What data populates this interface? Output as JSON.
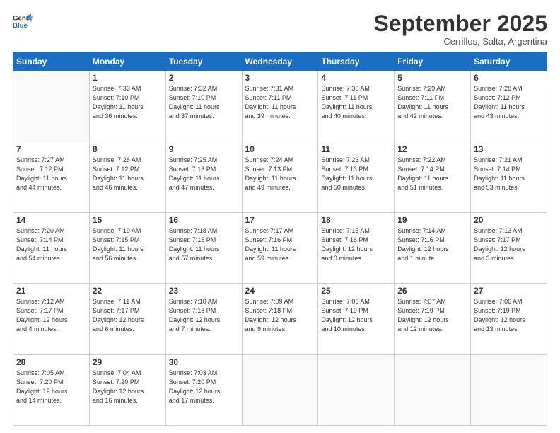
{
  "logo": {
    "general": "General",
    "blue": "Blue"
  },
  "title": "September 2025",
  "subtitle": "Cerrillos, Salta, Argentina",
  "days_of_week": [
    "Sunday",
    "Monday",
    "Tuesday",
    "Wednesday",
    "Thursday",
    "Friday",
    "Saturday"
  ],
  "weeks": [
    [
      {
        "num": "",
        "info": ""
      },
      {
        "num": "1",
        "info": "Sunrise: 7:33 AM\nSunset: 7:10 PM\nDaylight: 11 hours\nand 36 minutes."
      },
      {
        "num": "2",
        "info": "Sunrise: 7:32 AM\nSunset: 7:10 PM\nDaylight: 11 hours\nand 37 minutes."
      },
      {
        "num": "3",
        "info": "Sunrise: 7:31 AM\nSunset: 7:11 PM\nDaylight: 11 hours\nand 39 minutes."
      },
      {
        "num": "4",
        "info": "Sunrise: 7:30 AM\nSunset: 7:11 PM\nDaylight: 11 hours\nand 40 minutes."
      },
      {
        "num": "5",
        "info": "Sunrise: 7:29 AM\nSunset: 7:11 PM\nDaylight: 11 hours\nand 42 minutes."
      },
      {
        "num": "6",
        "info": "Sunrise: 7:28 AM\nSunset: 7:12 PM\nDaylight: 11 hours\nand 43 minutes."
      }
    ],
    [
      {
        "num": "7",
        "info": "Sunrise: 7:27 AM\nSunset: 7:12 PM\nDaylight: 11 hours\nand 44 minutes."
      },
      {
        "num": "8",
        "info": "Sunrise: 7:26 AM\nSunset: 7:12 PM\nDaylight: 11 hours\nand 46 minutes."
      },
      {
        "num": "9",
        "info": "Sunrise: 7:25 AM\nSunset: 7:13 PM\nDaylight: 11 hours\nand 47 minutes."
      },
      {
        "num": "10",
        "info": "Sunrise: 7:24 AM\nSunset: 7:13 PM\nDaylight: 11 hours\nand 49 minutes."
      },
      {
        "num": "11",
        "info": "Sunrise: 7:23 AM\nSunset: 7:13 PM\nDaylight: 11 hours\nand 50 minutes."
      },
      {
        "num": "12",
        "info": "Sunrise: 7:22 AM\nSunset: 7:14 PM\nDaylight: 11 hours\nand 51 minutes."
      },
      {
        "num": "13",
        "info": "Sunrise: 7:21 AM\nSunset: 7:14 PM\nDaylight: 11 hours\nand 53 minutes."
      }
    ],
    [
      {
        "num": "14",
        "info": "Sunrise: 7:20 AM\nSunset: 7:14 PM\nDaylight: 11 hours\nand 54 minutes."
      },
      {
        "num": "15",
        "info": "Sunrise: 7:19 AM\nSunset: 7:15 PM\nDaylight: 11 hours\nand 56 minutes."
      },
      {
        "num": "16",
        "info": "Sunrise: 7:18 AM\nSunset: 7:15 PM\nDaylight: 11 hours\nand 57 minutes."
      },
      {
        "num": "17",
        "info": "Sunrise: 7:17 AM\nSunset: 7:16 PM\nDaylight: 11 hours\nand 59 minutes."
      },
      {
        "num": "18",
        "info": "Sunrise: 7:15 AM\nSunset: 7:16 PM\nDaylight: 12 hours\nand 0 minutes."
      },
      {
        "num": "19",
        "info": "Sunrise: 7:14 AM\nSunset: 7:16 PM\nDaylight: 12 hours\nand 1 minute."
      },
      {
        "num": "20",
        "info": "Sunrise: 7:13 AM\nSunset: 7:17 PM\nDaylight: 12 hours\nand 3 minutes."
      }
    ],
    [
      {
        "num": "21",
        "info": "Sunrise: 7:12 AM\nSunset: 7:17 PM\nDaylight: 12 hours\nand 4 minutes."
      },
      {
        "num": "22",
        "info": "Sunrise: 7:11 AM\nSunset: 7:17 PM\nDaylight: 12 hours\nand 6 minutes."
      },
      {
        "num": "23",
        "info": "Sunrise: 7:10 AM\nSunset: 7:18 PM\nDaylight: 12 hours\nand 7 minutes."
      },
      {
        "num": "24",
        "info": "Sunrise: 7:09 AM\nSunset: 7:18 PM\nDaylight: 12 hours\nand 9 minutes."
      },
      {
        "num": "25",
        "info": "Sunrise: 7:08 AM\nSunset: 7:19 PM\nDaylight: 12 hours\nand 10 minutes."
      },
      {
        "num": "26",
        "info": "Sunrise: 7:07 AM\nSunset: 7:19 PM\nDaylight: 12 hours\nand 12 minutes."
      },
      {
        "num": "27",
        "info": "Sunrise: 7:06 AM\nSunset: 7:19 PM\nDaylight: 12 hours\nand 13 minutes."
      }
    ],
    [
      {
        "num": "28",
        "info": "Sunrise: 7:05 AM\nSunset: 7:20 PM\nDaylight: 12 hours\nand 14 minutes."
      },
      {
        "num": "29",
        "info": "Sunrise: 7:04 AM\nSunset: 7:20 PM\nDaylight: 12 hours\nand 16 minutes."
      },
      {
        "num": "30",
        "info": "Sunrise: 7:03 AM\nSunset: 7:20 PM\nDaylight: 12 hours\nand 17 minutes."
      },
      {
        "num": "",
        "info": ""
      },
      {
        "num": "",
        "info": ""
      },
      {
        "num": "",
        "info": ""
      },
      {
        "num": "",
        "info": ""
      }
    ]
  ]
}
